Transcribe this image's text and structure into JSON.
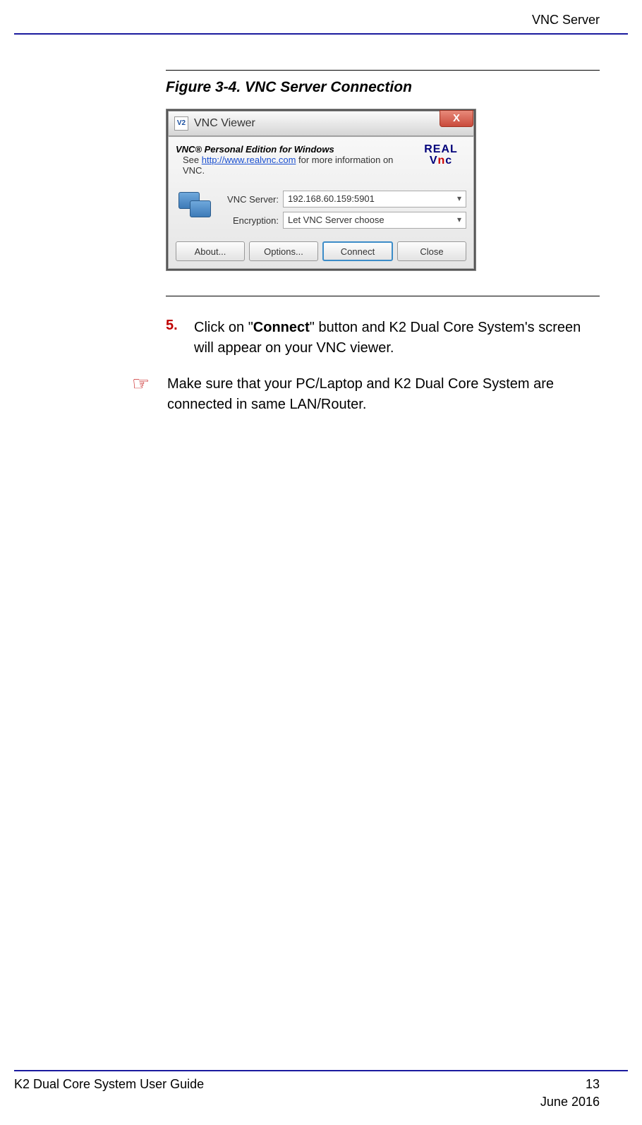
{
  "header": {
    "section": "VNC Server"
  },
  "figure": {
    "caption": "Figure 3-4.  VNC Server Connection"
  },
  "dialog": {
    "icon_badge": "V2",
    "title": "VNC Viewer",
    "close_glyph": "X",
    "edition": "VNC® Personal Edition for Windows",
    "info_prefix": "See ",
    "info_link": "http://www.realvnc.com",
    "info_suffix": " for more information on VNC.",
    "logo_top": "REAL",
    "logo_v": "V",
    "logo_n": "n",
    "logo_c": "c",
    "server_label": "VNC Server:",
    "server_value": "192.168.60.159:5901",
    "encryption_label": "Encryption:",
    "encryption_value": "Let VNC Server choose",
    "buttons": {
      "about": "About...",
      "options": "Options...",
      "connect": "Connect",
      "close": "Close"
    }
  },
  "step": {
    "number": "5.",
    "pre": "Click on \"",
    "bold": "Connect",
    "post": "\" button and K2 Dual Core System's screen will appear on your VNC viewer."
  },
  "note": {
    "glyph": "☞",
    "text": "Make sure that your PC/Laptop and K2 Dual Core System are connected in same LAN/Router."
  },
  "footer": {
    "guide": "K2 Dual Core System User Guide",
    "page": "13",
    "date": "June 2016"
  }
}
